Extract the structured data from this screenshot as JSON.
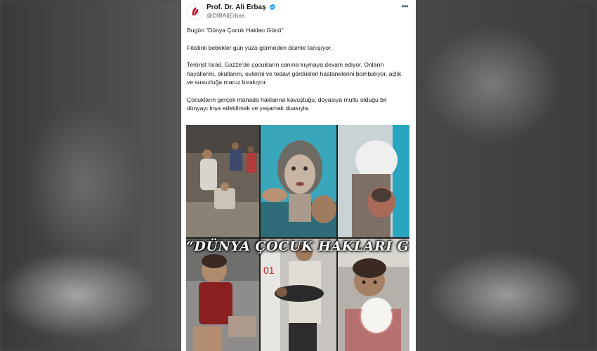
{
  "tweet": {
    "author_name": "Prof. Dr. Ali Erbaş",
    "author_handle": "@DIBAliErbas",
    "paragraphs": [
      "Bugün “Dünya Çocuk Hakları Günü”",
      "Filistinli bebekler gün yüzü görmeden ölümle tanışıyor.",
      "Terörist İsrail, Gazze’de çocukların canına kıymaya devam ediyor. Onların hayallerini, okullarını, evlerini ve tedavi gördükleri hastanelerini bombalıyor, açlık ve susuzluğa maruz bırakıyor.",
      "Çocukların gerçek manada haklarına kavuştuğu, doyasıya mutlu olduğu bir dünyayı inşa edebilmek ve yaşamak duasıyla."
    ],
    "more_label": "•••",
    "media": {
      "banner_text": "“DÜNYA ÇOCUK HAKLARI GÜNÜ”"
    }
  },
  "colors": {
    "verified": "#1d9bf0",
    "text": "#0f1419",
    "muted": "#536471"
  },
  "icons": {
    "avatar": "avatar-logo",
    "verified": "verified-badge-icon",
    "more": "more-options-icon"
  }
}
